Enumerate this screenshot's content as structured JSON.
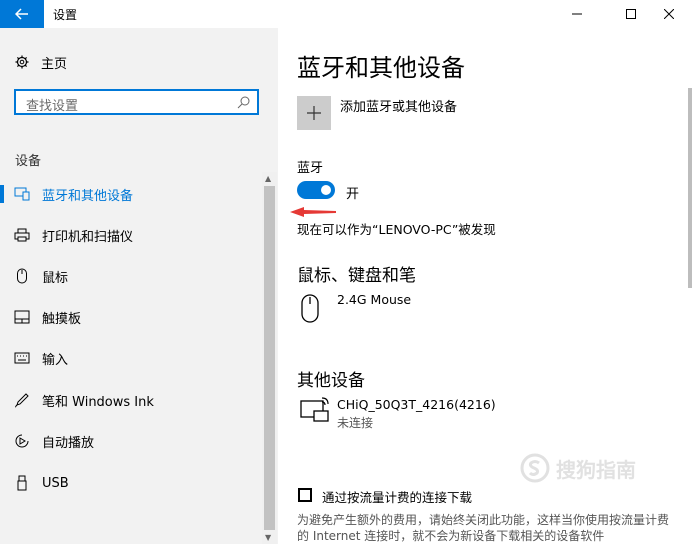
{
  "window": {
    "title": "设置"
  },
  "sidebar": {
    "home_label": "主页",
    "search_placeholder": "查找设置",
    "section_label": "设备",
    "items": [
      {
        "label": "蓝牙和其他设备",
        "icon": "bluetooth-devices-icon",
        "active": true
      },
      {
        "label": "打印机和扫描仪",
        "icon": "printer-icon"
      },
      {
        "label": "鼠标",
        "icon": "mouse-icon"
      },
      {
        "label": "触摸板",
        "icon": "touchpad-icon"
      },
      {
        "label": "输入",
        "icon": "keyboard-icon"
      },
      {
        "label": "笔和 Windows Ink",
        "icon": "pen-icon"
      },
      {
        "label": "自动播放",
        "icon": "autoplay-icon"
      },
      {
        "label": "USB",
        "icon": "usb-icon"
      }
    ]
  },
  "main": {
    "title": "蓝牙和其他设备",
    "add_label": "添加蓝牙或其他设备",
    "bluetooth_label": "蓝牙",
    "toggle_state": "开",
    "discoverable_text": "现在可以作为“LENOVO-PC”被发现",
    "mouse_section": "鼠标、键盘和笔",
    "mouse_device": "2.4G Mouse",
    "other_section": "其他设备",
    "other_device": "CHiQ_50Q3T_4216(4216)",
    "other_device_status": "未连接",
    "metered_label": "通过按流量计费的连接下载",
    "metered_desc": "为避免产生额外的费用，请始终关闭此功能，这样当你使用按流量计费的 Internet 连接时，就不会为新设备下载相关的设备软件"
  },
  "watermark": {
    "text": "搜狗指南"
  },
  "colors": {
    "accent": "#0078d7",
    "sidebar_bg": "#f2f2f2",
    "arrow": "#e53935"
  }
}
